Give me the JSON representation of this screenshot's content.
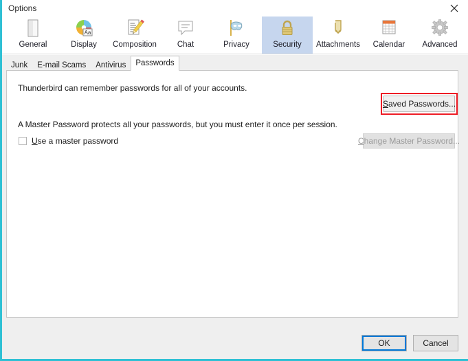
{
  "window": {
    "title": "Options",
    "close_icon": "close-icon",
    "accent_color": "#2fc0d4"
  },
  "toolbar": {
    "categories": [
      {
        "label": "General",
        "icon": "general-window-icon",
        "selected": false
      },
      {
        "label": "Display",
        "icon": "display-palette-icon",
        "selected": false
      },
      {
        "label": "Composition",
        "icon": "composition-pencil-icon",
        "selected": false
      },
      {
        "label": "Chat",
        "icon": "chat-bubble-icon",
        "selected": false
      },
      {
        "label": "Privacy",
        "icon": "privacy-mask-icon",
        "selected": false
      },
      {
        "label": "Security",
        "icon": "security-lock-icon",
        "selected": true
      },
      {
        "label": "Attachments",
        "icon": "attachments-clip-icon",
        "selected": false
      },
      {
        "label": "Calendar",
        "icon": "calendar-icon",
        "selected": false
      },
      {
        "label": "Advanced",
        "icon": "advanced-gear-icon",
        "selected": false
      }
    ],
    "selected_color": "#c6d6ee"
  },
  "tabs": [
    {
      "label": "Junk",
      "active": false
    },
    {
      "label": "E-mail Scams",
      "active": false
    },
    {
      "label": "Antivirus",
      "active": false
    },
    {
      "label": "Passwords",
      "active": true
    }
  ],
  "panel": {
    "remember_text": "Thunderbird can remember passwords for all of your accounts.",
    "master_text": "A Master Password protects all your passwords, but you must enter it once per session.",
    "checkbox": {
      "label_accel": "U",
      "label_rest": "se a master password",
      "checked": false
    },
    "saved_passwords_button": {
      "accel": "S",
      "rest": "aved Passwords...",
      "highlighted": true,
      "highlight_color": "#ee1c25"
    },
    "change_master_button": {
      "accel": "C",
      "rest": "hange Master Password...",
      "enabled": false
    }
  },
  "footer": {
    "ok_label": "OK",
    "cancel_label": "Cancel",
    "focus_color": "#0078d7"
  }
}
